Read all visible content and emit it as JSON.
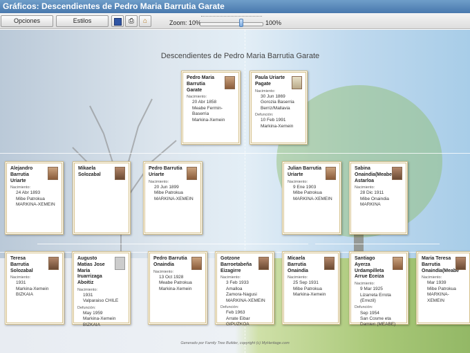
{
  "window": {
    "title": "Gráficos: Descendientes de Pedro Maria Barrutia Garate"
  },
  "toolbar": {
    "options_label": "Opciones",
    "styles_label": "Estilos",
    "zoom_label": "Zoom: 10%",
    "zoom_max_label": "100%",
    "zoom_level_percent": 70
  },
  "chart": {
    "title": "Descendientes de Pedro Maria Barrutia Garate",
    "footer": "Generado por Family Tree Builder, copyright (c) MyHeritage.com"
  },
  "people": {
    "p1": {
      "name": "Pedro Maria Barrutia Garate",
      "birth_label": "Nacimiento:",
      "lines": [
        "20 Abr 1858",
        "Meabe Fermin-Baserria",
        "Markina-Xemein"
      ]
    },
    "p2": {
      "name": "Paula Uriarte Pagate",
      "birth_label": "Nacimiento:",
      "lines": [
        "30 Jun 1869",
        "Gorozia Baserria",
        "Berriz/Mallavia"
      ],
      "death_label": "Defunción:",
      "death_lines": [
        "10 Feb 1991",
        "Markina-Xemein"
      ]
    },
    "c1": {
      "name": "Alejandro Barrutia Uriarte",
      "birth_label": "Nacimiento:",
      "lines": [
        "24 Abr 1893",
        "Mibe Patrokua",
        "MARKINA-XEMEIN"
      ]
    },
    "c2": {
      "name": "Mikaela Solozabal"
    },
    "c3": {
      "name": "Pedro Barrutia Uriarte",
      "birth_label": "Nacimiento:",
      "lines": [
        "20 Jun 1899",
        "Mibe Patrokua",
        "MARKINA-XEMEIN"
      ]
    },
    "c4": {
      "name": "Julian Barrutia Uriarte",
      "birth_label": "Nacimiento:",
      "lines": [
        "9 Ene 1903",
        "Mibe Patrokua",
        "MARKINA-XEMEIN"
      ]
    },
    "c5": {
      "name": "Sabina Onaindia(Meabe Astarloa",
      "birth_label": "Nacimiento:",
      "lines": [
        "28 Dic 1911",
        "Mibe Onaindia",
        "MARKINA"
      ]
    },
    "g1": {
      "name": "Teresa Barrutia Solozabal",
      "birth_label": "Nacimiento:",
      "lines": [
        "1931",
        "Markina-Xemein",
        "BIZKAIA"
      ]
    },
    "g2": {
      "name": "Augusto Matias Jose Maria Iruarrizaga Aboitiz",
      "birth_label": "Nacimiento:",
      "lines": [
        "1931",
        "Valparaiso CHILE"
      ],
      "death_label": "Defunción:",
      "death_lines": [
        "May 1959",
        "Markina-Xemein",
        "BIZKAIA"
      ]
    },
    "g3": {
      "name": "Pedro Barrutia Onaindia",
      "birth_label": "Nacimiento:",
      "lines": [
        "13 Oct 1928",
        "Meabe Patrokua",
        "Markina-Xemein"
      ]
    },
    "g4": {
      "name": "Gotzone Barroetabeña Eizagirre",
      "birth_label": "Nacimiento:",
      "lines": [
        "3 Feb 1933",
        "Amalloa",
        "Zamora-Nagusi",
        "MARKINA-XEMEIN"
      ],
      "death_label": "Defunción:",
      "death_lines": [
        "Feb 1963",
        "Arrate Eibar GIPUZKOA"
      ]
    },
    "g5": {
      "name": "Micaela Barrutia Onaindia",
      "birth_label": "Nacimiento:",
      "lines": [
        "25 Sep 1931",
        "Mibe Patrokua",
        "Markina-Xemein"
      ]
    },
    "g6": {
      "name": "Santiago Ayerza Urdampilleta Arrue Eceiza",
      "birth_label": "Nacimiento:",
      "lines": [
        "9 Mar 1925",
        "Lizarreta Errota (Errezil)"
      ],
      "death_label": "Defunción:",
      "death_lines": [
        "Sep 1954",
        "San Cosme eta",
        "Damien (MEABE)"
      ]
    },
    "g7": {
      "name": "Maria Teresa Barrutia Onaindia(Meabe",
      "birth_label": "Nacimiento:",
      "lines": [
        "Mar 1939",
        "Mibe Patrokua",
        "MARKINA-XEMEIN"
      ]
    }
  }
}
